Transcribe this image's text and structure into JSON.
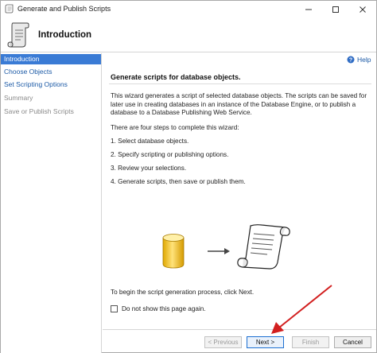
{
  "window": {
    "title": "Generate and Publish Scripts",
    "icons": {
      "app": "script-scroll-icon",
      "minimize": "minimize-icon",
      "maximize": "maximize-icon",
      "close": "close-icon"
    }
  },
  "header": {
    "title": "Introduction",
    "icon": "script-scroll-icon"
  },
  "sidebar": {
    "items": [
      {
        "label": "Introduction",
        "state": "active"
      },
      {
        "label": "Choose Objects",
        "state": "link"
      },
      {
        "label": "Set Scripting Options",
        "state": "link"
      },
      {
        "label": "Summary",
        "state": "disabled"
      },
      {
        "label": "Save or Publish Scripts",
        "state": "disabled"
      }
    ]
  },
  "content": {
    "help_label": "Help",
    "section_title": "Generate scripts for database objects.",
    "description": "This wizard generates a script of selected database objects. The scripts can be saved for later use in creating databases in an instance of the Database Engine, or to publish a database to a Database Publishing Web Service.",
    "steps_intro": "There are four steps to complete this wizard:",
    "steps": [
      "1. Select database objects.",
      "2. Specify scripting or publishing options.",
      "3. Review your selections.",
      "4. Generate scripts, then save or publish them."
    ],
    "begin_text": "To begin the script generation process, click Next.",
    "dont_show_label": "Do not show this page again.",
    "dont_show_checked": false
  },
  "buttons": {
    "previous": "< Previous",
    "next": "Next >",
    "finish": "Finish",
    "cancel": "Cancel"
  },
  "colors": {
    "accent": "#3a7bd5",
    "link": "#1c5aa6",
    "annotation_arrow": "#d21f1f",
    "database": "#f2c12e"
  }
}
